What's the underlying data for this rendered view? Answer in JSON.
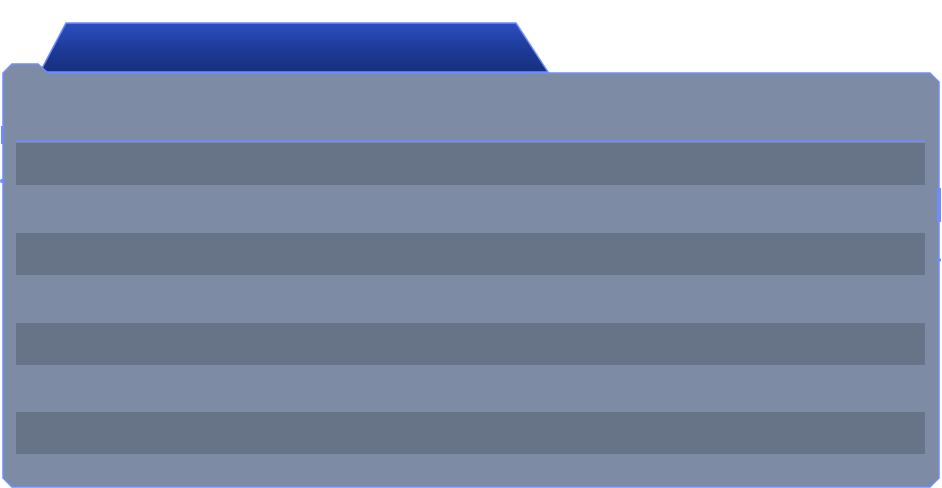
{
  "panel": {
    "tab_title": "",
    "rows": [
      {
        "label": ""
      },
      {
        "label": ""
      },
      {
        "label": ""
      },
      {
        "label": ""
      }
    ]
  },
  "colors": {
    "tab_fill_top": "#2b4fbf",
    "tab_fill_bottom": "#16307d",
    "panel_fill": "#7d8ba5",
    "row_fill": "#677386",
    "border": "#6f8cff"
  }
}
